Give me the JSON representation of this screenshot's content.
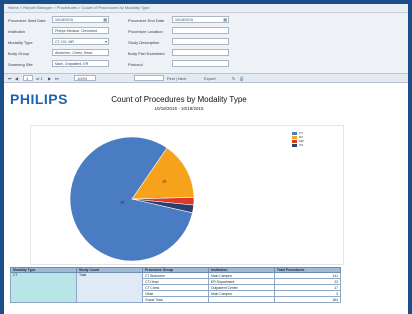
{
  "breadcrumb": "Home > Report Manager > Procedures > Count of Procedures by Modality Type",
  "params": {
    "left": [
      {
        "label": "Procedure Start Date",
        "value": "10/18/2015"
      },
      {
        "label": "Institution",
        "value": "Philips Medical, Cleveland"
      },
      {
        "label": "Modality Type",
        "value": "CT, DX, MR"
      },
      {
        "label": "Body Group",
        "value": "Abdomen, Chest, Head"
      },
      {
        "label": "Scanning Site",
        "value": "Main, Outpatient, ER"
      }
    ],
    "right": [
      {
        "label": "Procedure End Date",
        "value": "10/18/2015"
      },
      {
        "label": "Procedure Location",
        "value": ""
      },
      {
        "label": "Study Description",
        "value": ""
      },
      {
        "label": "Body Part Examined",
        "value": ""
      },
      {
        "label": "Protocol",
        "value": ""
      }
    ]
  },
  "toolbar": {
    "page": "1",
    "of_pages": "of 1",
    "find": "Find | Next",
    "zoom": "100%",
    "export": "Export"
  },
  "report": {
    "logo": "PHILIPS",
    "title": "Count of Procedures by Modality Type",
    "date_range": "10/18/2015 - 10/18/2015"
  },
  "chart_data": {
    "type": "pie",
    "title": "",
    "slices": [
      {
        "label": "CT",
        "value": 81,
        "color": "#4a7cc4"
      },
      {
        "label": "DX",
        "value": 15,
        "color": "#f7a21b"
      },
      {
        "label": "MR",
        "value": 2,
        "color": "#d93a2b"
      },
      {
        "label": "US",
        "value": 2,
        "color": "#2d3e6e"
      }
    ],
    "slice_labels": [
      "81",
      "15"
    ],
    "legend": [
      "CT",
      "DX",
      "MR",
      "US"
    ],
    "legend_position": "top-right"
  },
  "table": {
    "headers": [
      "Modality Type",
      "Study Count",
      "Procedure Group",
      "Institution",
      "Total Procedures"
    ],
    "modality": "CT",
    "study": "Total",
    "rows": [
      {
        "group": "CT Abdomen",
        "inst": "Main Campus",
        "total": "141"
      },
      {
        "group": "CT Head",
        "inst": "ER Department",
        "total": "23"
      },
      {
        "group": "CT Chest",
        "inst": "Outpatient Center",
        "total": "17"
      },
      {
        "group": "Other",
        "inst": "Main Campus",
        "total": "3"
      },
      {
        "group": "Grand Total",
        "inst": "",
        "total": "184"
      }
    ]
  },
  "colors": {
    "background": "#1b4f8a",
    "accent": "#1c63b5"
  }
}
